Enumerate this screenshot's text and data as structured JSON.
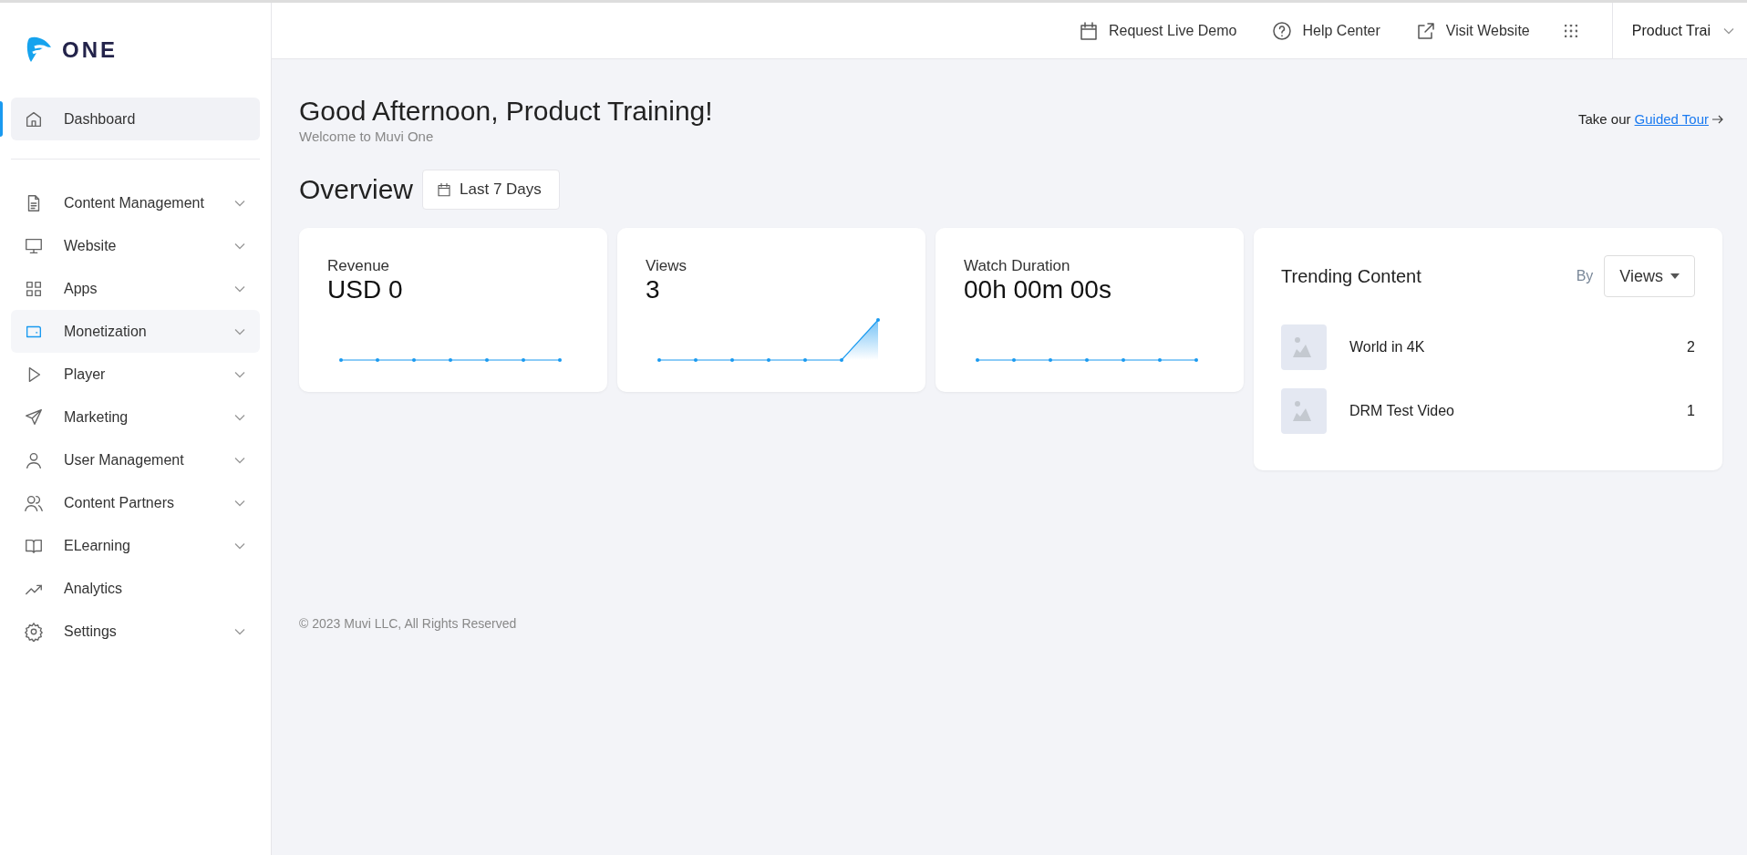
{
  "logo": {
    "text": "ONE"
  },
  "sidebar": {
    "items": [
      {
        "label": "Dashboard",
        "selected": true,
        "hovered": false,
        "expandable": false
      },
      {
        "label": "Content Management",
        "selected": false,
        "hovered": false,
        "expandable": true
      },
      {
        "label": "Website",
        "selected": false,
        "hovered": false,
        "expandable": true
      },
      {
        "label": "Apps",
        "selected": false,
        "hovered": false,
        "expandable": true
      },
      {
        "label": "Monetization",
        "selected": false,
        "hovered": true,
        "expandable": true
      },
      {
        "label": "Player",
        "selected": false,
        "hovered": false,
        "expandable": true
      },
      {
        "label": "Marketing",
        "selected": false,
        "hovered": false,
        "expandable": true
      },
      {
        "label": "User Management",
        "selected": false,
        "hovered": false,
        "expandable": true
      },
      {
        "label": "Content Partners",
        "selected": false,
        "hovered": false,
        "expandable": true
      },
      {
        "label": "ELearning",
        "selected": false,
        "hovered": false,
        "expandable": true
      },
      {
        "label": "Analytics",
        "selected": false,
        "hovered": false,
        "expandable": false
      },
      {
        "label": "Settings",
        "selected": false,
        "hovered": false,
        "expandable": true
      }
    ]
  },
  "topbar": {
    "links": [
      {
        "label": "Request Live Demo"
      },
      {
        "label": "Help Center"
      },
      {
        "label": "Visit Website"
      }
    ],
    "account": "Product Trai"
  },
  "greeting": {
    "title": "Good Afternoon, Product Training!",
    "subtitle": "Welcome to Muvi One",
    "tour_prefix": "Take our",
    "tour_link": "Guided Tour"
  },
  "overview": {
    "title": "Overview",
    "range": "Last 7 Days"
  },
  "stats": [
    {
      "label": "Revenue",
      "value": "USD 0",
      "kind": "flat"
    },
    {
      "label": "Views",
      "value": "3",
      "kind": "spike"
    },
    {
      "label": "Watch Duration",
      "value": "00h 00m 00s",
      "kind": "flat"
    }
  ],
  "trending": {
    "title": "Trending Content",
    "by_label": "By",
    "by_value": "Views",
    "items": [
      {
        "title": "World in 4K",
        "count": "2"
      },
      {
        "title": "DRM Test Video",
        "count": "1"
      }
    ]
  },
  "footer": "© 2023 Muvi LLC, All Rights Reserved"
}
